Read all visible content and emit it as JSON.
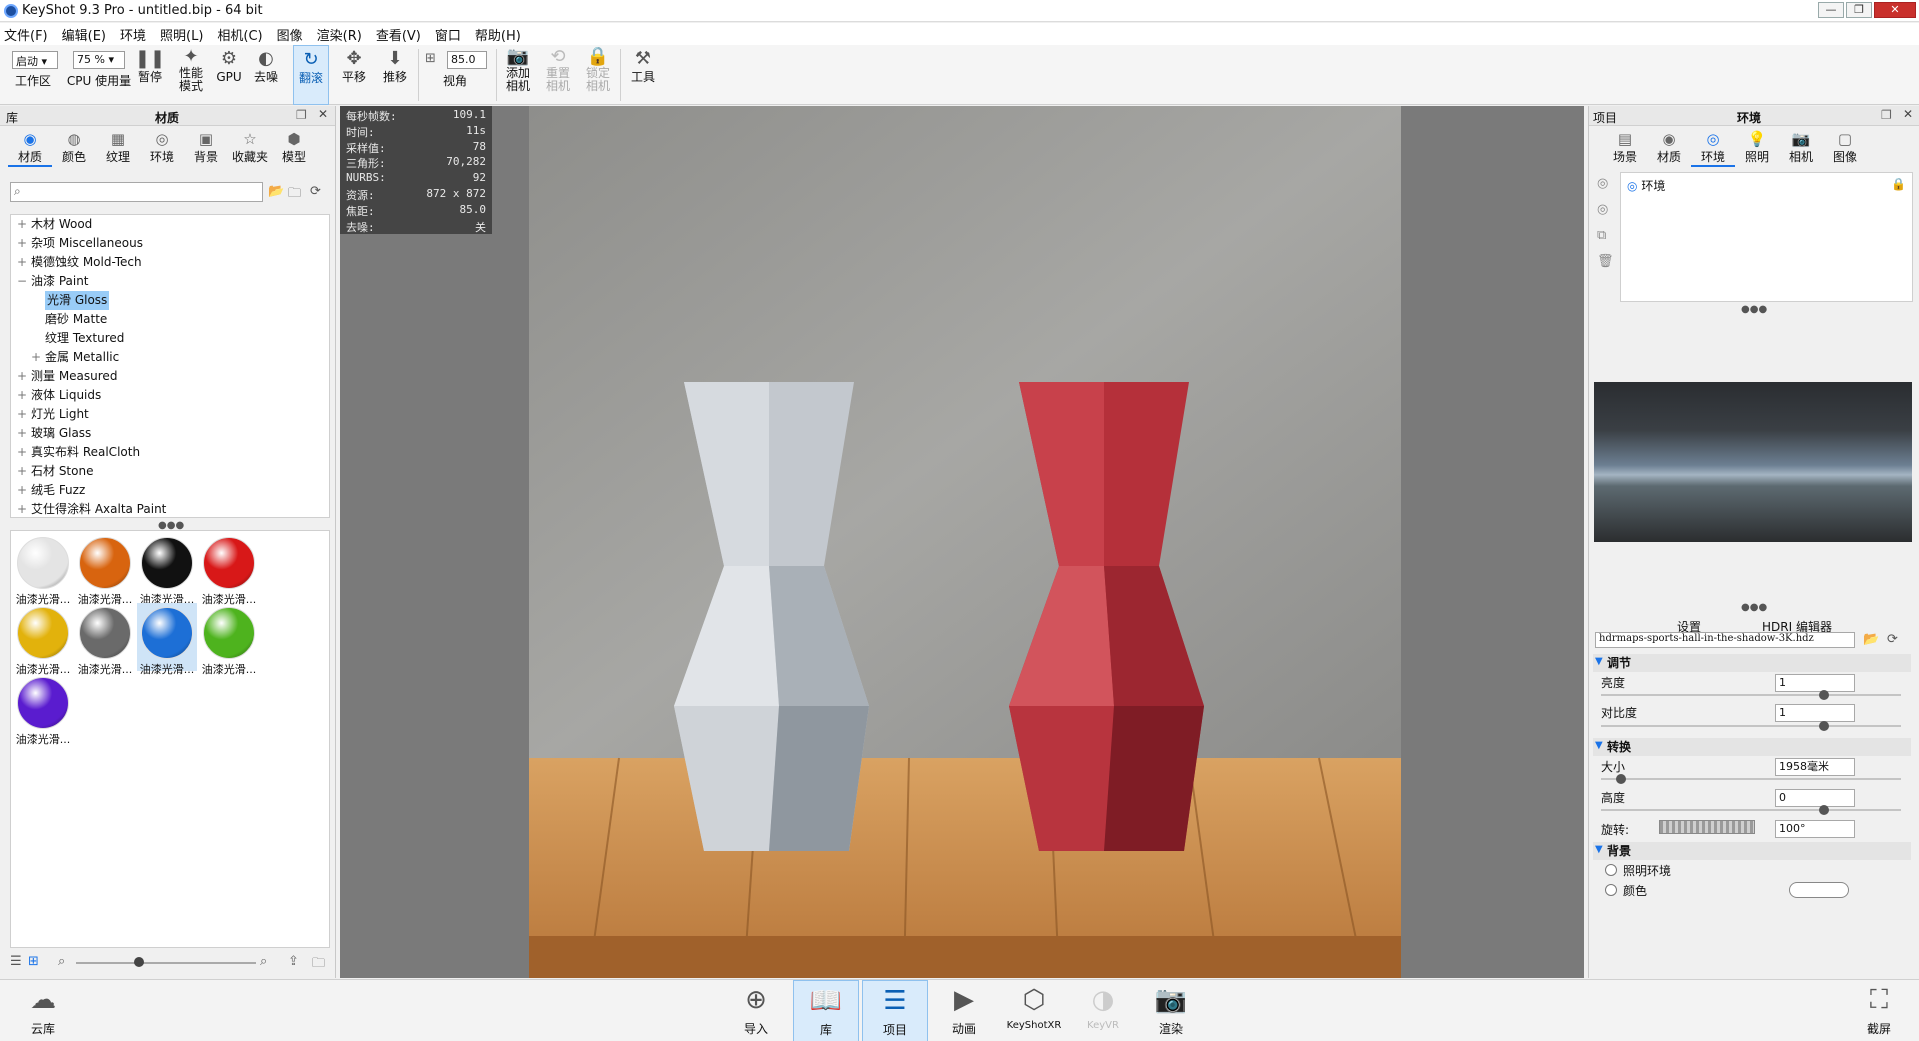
{
  "window": {
    "title": "KeyShot 9.3 Pro  - untitled.bip  - 64 bit"
  },
  "menu": [
    "文件(F)",
    "编辑(E)",
    "环境",
    "照明(L)",
    "相机(C)",
    "图像",
    "渲染(R)",
    "查看(V)",
    "窗口",
    "帮助(H)"
  ],
  "toolbar": {
    "workspace_select": "启动",
    "workspace_label": "工作区",
    "cpu_select": "75 %",
    "cpu_label": "CPU 使用量",
    "pause_label": "暂停",
    "perf_label_1": "性能",
    "perf_label_2": "模式",
    "gpu_label": "GPU",
    "denoise_label": "去噪",
    "tumble_label": "翻滚",
    "pan_label": "平移",
    "dolly_label": "推移",
    "fov_value": "85.0",
    "fov_label": "视角",
    "add_cam_1": "添加",
    "add_cam_2": "相机",
    "reset_cam_1": "重置",
    "reset_cam_2": "相机",
    "lock_cam_1": "锁定",
    "lock_cam_2": "相机",
    "tools_label": "工具"
  },
  "library": {
    "header_left": "库",
    "header_title": "材质",
    "tabs": [
      {
        "label": "材质",
        "icon": "material-icon"
      },
      {
        "label": "颜色",
        "icon": "color-icon"
      },
      {
        "label": "纹理",
        "icon": "texture-icon"
      },
      {
        "label": "环境",
        "icon": "environment-icon"
      },
      {
        "label": "背景",
        "icon": "background-icon"
      },
      {
        "label": "收藏夹",
        "icon": "favorites-icon"
      },
      {
        "label": "模型",
        "icon": "model-icon"
      }
    ],
    "search_placeholder": "",
    "tree": [
      {
        "label": "木材 Wood",
        "level": 0,
        "exp": "+"
      },
      {
        "label": "杂项 Miscellaneous",
        "level": 0,
        "exp": "+"
      },
      {
        "label": "模德蚀纹 Mold-Tech",
        "level": 0,
        "exp": "+"
      },
      {
        "label": "油漆 Paint",
        "level": 0,
        "exp": "−"
      },
      {
        "label": "光滑 Gloss",
        "level": 1,
        "exp": "",
        "selected": true
      },
      {
        "label": "磨砂 Matte",
        "level": 1,
        "exp": ""
      },
      {
        "label": "纹理 Textured",
        "level": 1,
        "exp": ""
      },
      {
        "label": "金属 Metallic",
        "level": 1,
        "exp": "+"
      },
      {
        "label": "测量 Measured",
        "level": 0,
        "exp": "+"
      },
      {
        "label": "液体 Liquids",
        "level": 0,
        "exp": "+"
      },
      {
        "label": "灯光 Light",
        "level": 0,
        "exp": "+"
      },
      {
        "label": "玻璃 Glass",
        "level": 0,
        "exp": "+"
      },
      {
        "label": "真实布料 RealCloth",
        "level": 0,
        "exp": "+"
      },
      {
        "label": "石材 Stone",
        "level": 0,
        "exp": "+"
      },
      {
        "label": "绒毛 Fuzz",
        "level": 0,
        "exp": "+"
      },
      {
        "label": "艾仕得涂料 Axalta Paint",
        "level": 0,
        "exp": "+"
      }
    ],
    "thumbnails": [
      {
        "label": "油漆光滑...",
        "color": "#e4e4e4"
      },
      {
        "label": "油漆光滑...",
        "color": "#d8640f"
      },
      {
        "label": "油漆光滑...",
        "color": "#111111"
      },
      {
        "label": "油漆光滑...",
        "color": "#d81818"
      },
      {
        "label": "油漆光滑...",
        "color": "#e2b20c"
      },
      {
        "label": "油漆光滑...",
        "color": "#6a6a6a"
      },
      {
        "label": "油漆光滑...",
        "color": "#1d6fd6",
        "selected": true
      },
      {
        "label": "油漆光滑...",
        "color": "#4eb31e"
      },
      {
        "label": "油漆光滑...",
        "color": "#5a1ccf"
      }
    ]
  },
  "stats": [
    {
      "k": "每秒帧数:",
      "v": "109.1"
    },
    {
      "k": "时间:",
      "v": "11s"
    },
    {
      "k": "采样值:",
      "v": "78"
    },
    {
      "k": "三角形:",
      "v": "70,282"
    },
    {
      "k": "NURBS:",
      "v": "92"
    },
    {
      "k": "资源:",
      "v": "872 x 872"
    },
    {
      "k": "焦距:",
      "v": "85.0"
    },
    {
      "k": "去噪:",
      "v": "关"
    }
  ],
  "project": {
    "header_left": "项目",
    "header_title": "环境",
    "tabs": [
      {
        "label": "场景",
        "icon": "scene-icon"
      },
      {
        "label": "材质",
        "icon": "material-icon"
      },
      {
        "label": "环境",
        "icon": "environment-icon"
      },
      {
        "label": "照明",
        "icon": "lighting-icon"
      },
      {
        "label": "相机",
        "icon": "camera-icon"
      },
      {
        "label": "图像",
        "icon": "image-icon"
      }
    ],
    "env_item": "环境",
    "subtabs": [
      "设置",
      "HDRI 编辑器"
    ],
    "hdr_file": "hdrmaps-sports-hall-in-the-shadow-3K.hdz",
    "adjust_header": "调节",
    "brightness_label": "亮度",
    "brightness_value": "1",
    "brightness_level": 0.75,
    "contrast_label": "对比度",
    "contrast_value": "1",
    "contrast_level": 0.75,
    "transform_header": "转换",
    "size_label": "大小",
    "size_value": "1958毫米",
    "size_level": 0.05,
    "height_label": "高度",
    "height_value": "0",
    "height_level": 0.75,
    "rotation_label": "旋转:",
    "rotation_value": "100°",
    "background_header": "背景",
    "bg_option1": "照明环境",
    "bg_option2": "颜色"
  },
  "bottom": {
    "cloud": "云库",
    "import": "导入",
    "library": "库",
    "project": "项目",
    "animation": "动画",
    "xr": "KeyShotXR",
    "vr": "KeyVR",
    "render": "渲染",
    "screenshot": "截屏"
  },
  "colors": {
    "accent": "#1a73e8",
    "vase_left": "#c9ced4",
    "vase_right": "#b8323a"
  }
}
